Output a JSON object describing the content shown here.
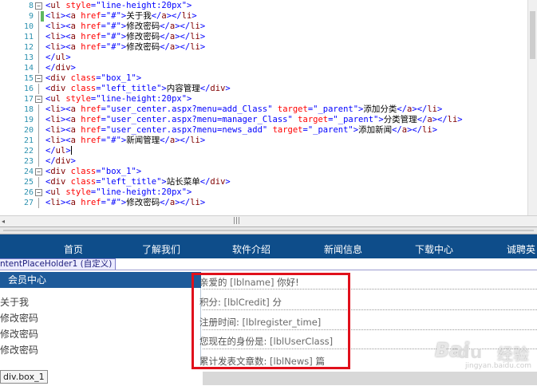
{
  "editor": {
    "lines": [
      {
        "num": "8",
        "fold": "-",
        "changed": false,
        "segs": [
          [
            "t",
            "<"
          ],
          [
            "n",
            "ul"
          ],
          [
            "x",
            " "
          ],
          [
            "a",
            "style"
          ],
          [
            "t",
            "=\""
          ],
          [
            "v",
            "line-height:20px"
          ],
          [
            "t",
            "\">"
          ]
        ]
      },
      {
        "num": "9",
        "fold": "|",
        "changed": true,
        "segs": [
          [
            "t",
            "<"
          ],
          [
            "n",
            "li"
          ],
          [
            "t",
            "><"
          ],
          [
            "n",
            "a"
          ],
          [
            "x",
            " "
          ],
          [
            "a",
            "href"
          ],
          [
            "t",
            "=\""
          ],
          [
            "v",
            "#"
          ],
          [
            "t",
            "\">"
          ],
          [
            "x",
            "关于我"
          ],
          [
            "t",
            "</"
          ],
          [
            "n",
            "a"
          ],
          [
            "t",
            "></"
          ],
          [
            "n",
            "li"
          ],
          [
            "t",
            ">"
          ]
        ]
      },
      {
        "num": "10",
        "fold": "|",
        "changed": false,
        "segs": [
          [
            "t",
            "<"
          ],
          [
            "n",
            "li"
          ],
          [
            "t",
            "><"
          ],
          [
            "n",
            "a"
          ],
          [
            "x",
            " "
          ],
          [
            "a",
            "href"
          ],
          [
            "t",
            "=\""
          ],
          [
            "v",
            "#"
          ],
          [
            "t",
            "\">"
          ],
          [
            "x",
            "修改密码"
          ],
          [
            "t",
            "</"
          ],
          [
            "n",
            "a"
          ],
          [
            "t",
            "></"
          ],
          [
            "n",
            "li"
          ],
          [
            "t",
            ">"
          ]
        ]
      },
      {
        "num": "11",
        "fold": "|",
        "changed": false,
        "segs": [
          [
            "t",
            "<"
          ],
          [
            "n",
            "li"
          ],
          [
            "t",
            "><"
          ],
          [
            "n",
            "a"
          ],
          [
            "x",
            " "
          ],
          [
            "a",
            "href"
          ],
          [
            "t",
            "=\""
          ],
          [
            "v",
            "#"
          ],
          [
            "t",
            "\">"
          ],
          [
            "x",
            "修改密码"
          ],
          [
            "t",
            "</"
          ],
          [
            "n",
            "a"
          ],
          [
            "t",
            "></"
          ],
          [
            "n",
            "li"
          ],
          [
            "t",
            ">"
          ]
        ]
      },
      {
        "num": "12",
        "fold": "|",
        "changed": false,
        "segs": [
          [
            "t",
            "<"
          ],
          [
            "n",
            "li"
          ],
          [
            "t",
            "><"
          ],
          [
            "n",
            "a"
          ],
          [
            "x",
            " "
          ],
          [
            "a",
            "href"
          ],
          [
            "t",
            "=\""
          ],
          [
            "v",
            "#"
          ],
          [
            "t",
            "\">"
          ],
          [
            "x",
            "修改密码"
          ],
          [
            "t",
            "</"
          ],
          [
            "n",
            "a"
          ],
          [
            "t",
            "></"
          ],
          [
            "n",
            "li"
          ],
          [
            "t",
            ">"
          ]
        ]
      },
      {
        "num": "13",
        "fold": "|",
        "changed": false,
        "segs": [
          [
            "t",
            "</"
          ],
          [
            "n",
            "ul"
          ],
          [
            "t",
            ">"
          ]
        ]
      },
      {
        "num": "14",
        "fold": "|",
        "changed": false,
        "segs": [
          [
            "t",
            "</"
          ],
          [
            "n",
            "div"
          ],
          [
            "t",
            ">"
          ]
        ]
      },
      {
        "num": "15",
        "fold": "-",
        "changed": false,
        "segs": [
          [
            "t",
            "<"
          ],
          [
            "n",
            "div"
          ],
          [
            "x",
            " "
          ],
          [
            "a",
            "class"
          ],
          [
            "t",
            "=\""
          ],
          [
            "v",
            "box_1"
          ],
          [
            "t",
            "\">"
          ]
        ]
      },
      {
        "num": "16",
        "fold": "|",
        "changed": false,
        "segs": [
          [
            "t",
            "<"
          ],
          [
            "n",
            "div"
          ],
          [
            "x",
            " "
          ],
          [
            "a",
            "class"
          ],
          [
            "t",
            "=\""
          ],
          [
            "v",
            "left_title"
          ],
          [
            "t",
            "\">"
          ],
          [
            "x",
            "内容管理"
          ],
          [
            "t",
            "</"
          ],
          [
            "n",
            "div"
          ],
          [
            "t",
            ">"
          ]
        ]
      },
      {
        "num": "17",
        "fold": "-",
        "changed": false,
        "segs": [
          [
            "t",
            "<"
          ],
          [
            "n",
            "ul"
          ],
          [
            "x",
            " "
          ],
          [
            "a",
            "style"
          ],
          [
            "t",
            "=\""
          ],
          [
            "v",
            "line-height:20px"
          ],
          [
            "t",
            "\">"
          ]
        ]
      },
      {
        "num": "18",
        "fold": "|",
        "changed": false,
        "segs": [
          [
            "t",
            "<"
          ],
          [
            "n",
            "li"
          ],
          [
            "t",
            "><"
          ],
          [
            "n",
            "a"
          ],
          [
            "x",
            " "
          ],
          [
            "a",
            "href"
          ],
          [
            "t",
            "=\""
          ],
          [
            "v",
            "user_center.aspx?menu=add_Class"
          ],
          [
            "t",
            "\" "
          ],
          [
            "a",
            "target"
          ],
          [
            "t",
            "=\""
          ],
          [
            "v",
            "_parent"
          ],
          [
            "t",
            "\">"
          ],
          [
            "x",
            "添加分类"
          ],
          [
            "t",
            "</"
          ],
          [
            "n",
            "a"
          ],
          [
            "t",
            "></"
          ],
          [
            "n",
            "li"
          ],
          [
            "t",
            ">"
          ]
        ]
      },
      {
        "num": "19",
        "fold": "|",
        "changed": false,
        "segs": [
          [
            "t",
            "<"
          ],
          [
            "n",
            "li"
          ],
          [
            "t",
            "><"
          ],
          [
            "n",
            "a"
          ],
          [
            "x",
            " "
          ],
          [
            "a",
            "href"
          ],
          [
            "t",
            "=\""
          ],
          [
            "v",
            "user_center.aspx?menu=manager_Class"
          ],
          [
            "t",
            "\" "
          ],
          [
            "a",
            "target"
          ],
          [
            "t",
            "=\""
          ],
          [
            "v",
            "_parent"
          ],
          [
            "t",
            "\">"
          ],
          [
            "x",
            "分类管理"
          ],
          [
            "t",
            "</"
          ],
          [
            "n",
            "a"
          ],
          [
            "t",
            "></"
          ],
          [
            "n",
            "li"
          ],
          [
            "t",
            ">"
          ]
        ]
      },
      {
        "num": "20",
        "fold": "|",
        "changed": false,
        "segs": [
          [
            "t",
            "<"
          ],
          [
            "n",
            "li"
          ],
          [
            "t",
            "><"
          ],
          [
            "n",
            "a"
          ],
          [
            "x",
            " "
          ],
          [
            "a",
            "href"
          ],
          [
            "t",
            "=\""
          ],
          [
            "v",
            "user_center.aspx?menu=news_add"
          ],
          [
            "t",
            "\" "
          ],
          [
            "a",
            "target"
          ],
          [
            "t",
            "=\""
          ],
          [
            "v",
            "_parent"
          ],
          [
            "t",
            "\">"
          ],
          [
            "x",
            "添加新闻"
          ],
          [
            "t",
            "</"
          ],
          [
            "n",
            "a"
          ],
          [
            "t",
            "></"
          ],
          [
            "n",
            "li"
          ],
          [
            "t",
            ">"
          ]
        ]
      },
      {
        "num": "21",
        "fold": "|",
        "changed": false,
        "segs": [
          [
            "t",
            "<"
          ],
          [
            "n",
            "li"
          ],
          [
            "t",
            "><"
          ],
          [
            "n",
            "a"
          ],
          [
            "x",
            " "
          ],
          [
            "a",
            "href"
          ],
          [
            "t",
            "=\""
          ],
          [
            "v",
            "#"
          ],
          [
            "t",
            "\">"
          ],
          [
            "x",
            "新闻管理"
          ],
          [
            "t",
            "</"
          ],
          [
            "n",
            "a"
          ],
          [
            "t",
            "></"
          ],
          [
            "n",
            "li"
          ],
          [
            "t",
            ">"
          ]
        ]
      },
      {
        "num": "22",
        "fold": "|",
        "changed": false,
        "segs": [
          [
            "t",
            "</"
          ],
          [
            "n",
            "ul"
          ],
          [
            "t",
            ">"
          ]
        ],
        "cursor": true
      },
      {
        "num": "23",
        "fold": "|",
        "changed": false,
        "segs": [
          [
            "t",
            "</"
          ],
          [
            "n",
            "div"
          ],
          [
            "t",
            ">"
          ]
        ]
      },
      {
        "num": "24",
        "fold": "-",
        "changed": false,
        "segs": [
          [
            "t",
            "<"
          ],
          [
            "n",
            "div"
          ],
          [
            "x",
            " "
          ],
          [
            "a",
            "class"
          ],
          [
            "t",
            "=\""
          ],
          [
            "v",
            "box_1"
          ],
          [
            "t",
            "\">"
          ]
        ]
      },
      {
        "num": "25",
        "fold": "|",
        "changed": false,
        "segs": [
          [
            "t",
            "<"
          ],
          [
            "n",
            "div"
          ],
          [
            "x",
            " "
          ],
          [
            "a",
            "class"
          ],
          [
            "t",
            "=\""
          ],
          [
            "v",
            "left_title"
          ],
          [
            "t",
            "\">"
          ],
          [
            "x",
            "站长菜单"
          ],
          [
            "t",
            "</"
          ],
          [
            "n",
            "div"
          ],
          [
            "t",
            ">"
          ]
        ]
      },
      {
        "num": "26",
        "fold": "-",
        "changed": false,
        "segs": [
          [
            "t",
            "<"
          ],
          [
            "n",
            "ul"
          ],
          [
            "x",
            " "
          ],
          [
            "a",
            "style"
          ],
          [
            "t",
            "=\""
          ],
          [
            "v",
            "line-height:20px"
          ],
          [
            "t",
            "\">"
          ]
        ]
      },
      {
        "num": "27",
        "fold": "|",
        "changed": false,
        "segs": [
          [
            "t",
            "<"
          ],
          [
            "n",
            "li"
          ],
          [
            "t",
            "><"
          ],
          [
            "n",
            "a"
          ],
          [
            "x",
            " "
          ],
          [
            "a",
            "href"
          ],
          [
            "t",
            "=\""
          ],
          [
            "v",
            "#"
          ],
          [
            "t",
            "\">"
          ],
          [
            "x",
            "修改密码"
          ],
          [
            "t",
            "</"
          ],
          [
            "n",
            "a"
          ],
          [
            "t",
            "></"
          ],
          [
            "n",
            "li"
          ],
          [
            "t",
            ">"
          ]
        ]
      }
    ],
    "hscroll_grip": "|||"
  },
  "design": {
    "nav_items": [
      "首页",
      "了解我们",
      "软件介绍",
      "新闻信息",
      "下载中心",
      "诚聘英"
    ],
    "placeholder_tab": "ntentPlaceHolder1 (自定义)",
    "member_title": "会员中心",
    "menu_links": [
      "关于我",
      "修改密码",
      "修改密码",
      "修改密码"
    ],
    "box_tag": "div.box_1",
    "info": {
      "greeting_prefix": "亲爱的",
      "greeting_field": "[lblname]",
      "greeting_suffix": "你好!",
      "credit_label": "积分:",
      "credit_field": "[lblCredit]",
      "credit_unit": "分",
      "reg_label": "注册时间:",
      "reg_field": "[lblregister_time]",
      "class_label": "您现在的身份是:",
      "class_field": "[lblUserClass]",
      "news_label": "累计发表文章数:",
      "news_field": "[lblNews]",
      "news_unit": "篇"
    },
    "highlight_color": "#e0101b"
  },
  "watermark": {
    "brand": "Bai",
    "paw": "du",
    "cn": "经验",
    "url": "jingyan.baidu.com"
  }
}
